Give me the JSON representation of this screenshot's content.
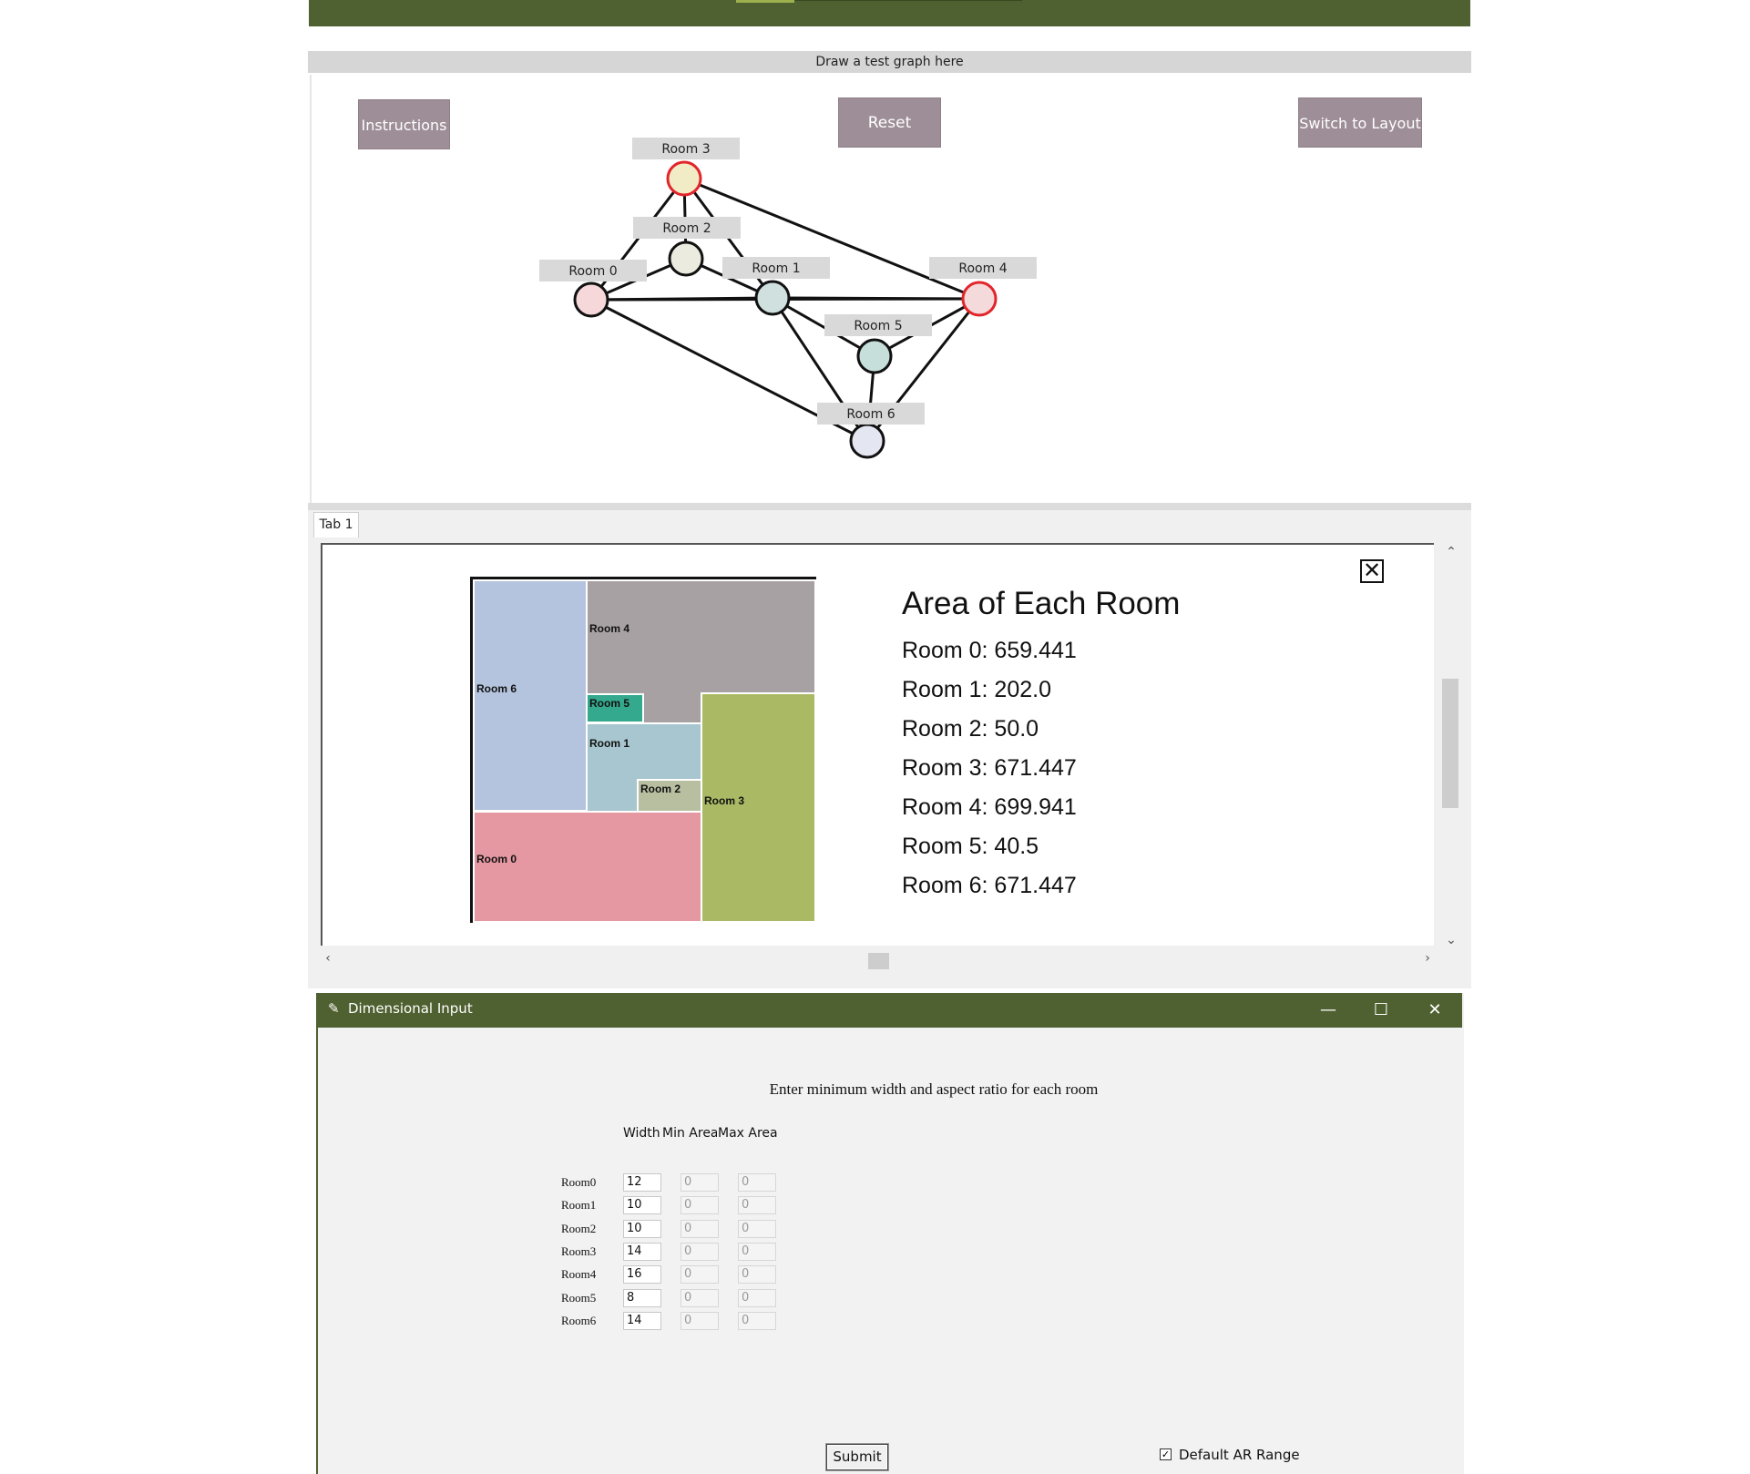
{
  "graph_panel": {
    "title": "Draw a test graph here",
    "instructions_label": "Instructions",
    "reset_label": "Reset",
    "switch_layout_label": "Switch to Layout",
    "nodes": [
      {
        "id": "Room 0",
        "label": "Room 0",
        "fill": "#f6d7da",
        "stroke": "#111111"
      },
      {
        "id": "Room 1",
        "label": "Room 1",
        "fill": "#cfe0df",
        "stroke": "#111111"
      },
      {
        "id": "Room 2",
        "label": "Room 2",
        "fill": "#ecebe0",
        "stroke": "#111111"
      },
      {
        "id": "Room 3",
        "label": "Room 3",
        "fill": "#f1ecc6",
        "stroke": "#e2252b"
      },
      {
        "id": "Room 4",
        "label": "Room 4",
        "fill": "#f4dada",
        "stroke": "#e2252b"
      },
      {
        "id": "Room 5",
        "label": "Room 5",
        "fill": "#c6dfda",
        "stroke": "#111111"
      },
      {
        "id": "Room 6",
        "label": "Room 6",
        "fill": "#e4e6f1",
        "stroke": "#111111"
      }
    ],
    "edges": [
      [
        "Room 3",
        "Room 2"
      ],
      [
        "Room 3",
        "Room 0"
      ],
      [
        "Room 3",
        "Room 1"
      ],
      [
        "Room 3",
        "Room 4"
      ],
      [
        "Room 2",
        "Room 0"
      ],
      [
        "Room 2",
        "Room 1"
      ],
      [
        "Room 0",
        "Room 1"
      ],
      [
        "Room 0",
        "Room 4"
      ],
      [
        "Room 0",
        "Room 6"
      ],
      [
        "Room 1",
        "Room 4"
      ],
      [
        "Room 1",
        "Room 5"
      ],
      [
        "Room 1",
        "Room 6"
      ],
      [
        "Room 4",
        "Room 5"
      ],
      [
        "Room 4",
        "Room 6"
      ],
      [
        "Room 5",
        "Room 6"
      ]
    ]
  },
  "tabs": [
    {
      "label": "Tab 1"
    }
  ],
  "layout_panel": {
    "close_glyph": "✕",
    "rooms": [
      {
        "name": "Room 6",
        "label": "Room 6",
        "color": "#b4c3de"
      },
      {
        "name": "Room 4",
        "label": "Room 4",
        "color": "#a8a1a4"
      },
      {
        "name": "Room 5",
        "label": "Room 5",
        "color": "#35a98e"
      },
      {
        "name": "Room 1",
        "label": "Room 1",
        "color": "#a7c6cf"
      },
      {
        "name": "Room 2",
        "label": "Room 2",
        "color": "#b8bfa0"
      },
      {
        "name": "Room 3",
        "label": "Room 3",
        "color": "#a9b964"
      },
      {
        "name": "Room 0",
        "label": "Room 0",
        "color": "#e598a2"
      }
    ],
    "areas_title": "Area of Each Room",
    "areas": [
      "Room 0: 659.441",
      "Room 1: 202.0",
      "Room 2: 50.0",
      "Room 3: 671.447",
      "Room 4: 699.941",
      "Room 5: 40.5",
      "Room 6: 671.447"
    ]
  },
  "dialog": {
    "title": "Dimensional Input",
    "heading": "Enter minimum width and aspect ratio for each room",
    "columns": [
      "Width",
      "Min Area",
      "Max Area"
    ],
    "rows": [
      {
        "label": "Room0",
        "width": "12",
        "min_area": "0",
        "max_area": "0"
      },
      {
        "label": "Room1",
        "width": "10",
        "min_area": "0",
        "max_area": "0"
      },
      {
        "label": "Room2",
        "width": "10",
        "min_area": "0",
        "max_area": "0"
      },
      {
        "label": "Room3",
        "width": "14",
        "min_area": "0",
        "max_area": "0"
      },
      {
        "label": "Room4",
        "width": "16",
        "min_area": "0",
        "max_area": "0"
      },
      {
        "label": "Room5",
        "width": "8",
        "min_area": "0",
        "max_area": "0"
      },
      {
        "label": "Room6",
        "width": "14",
        "min_area": "0",
        "max_area": "0"
      }
    ],
    "submit_label": "Submit",
    "default_ar_label": "Default AR Range",
    "default_ar_checked": true,
    "window_controls": {
      "minimize": "—",
      "maximize": "☐",
      "close": "✕"
    }
  }
}
